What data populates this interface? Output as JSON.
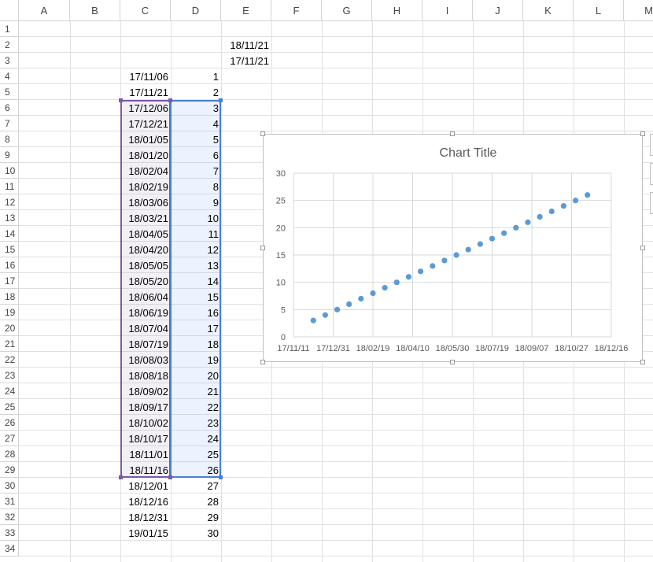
{
  "columns": [
    "A",
    "B",
    "C",
    "D",
    "E",
    "F",
    "G",
    "H",
    "I",
    "J",
    "K",
    "L",
    "M"
  ],
  "rows": [
    "1",
    "2",
    "3",
    "4",
    "5",
    "6",
    "7",
    "8",
    "9",
    "10",
    "11",
    "12",
    "13",
    "14",
    "15",
    "16",
    "17",
    "18",
    "19",
    "20",
    "21",
    "22",
    "23",
    "24",
    "25",
    "26",
    "27",
    "28",
    "29",
    "30",
    "31",
    "32",
    "33",
    "34"
  ],
  "cells": {
    "E2": "18/11/21",
    "E3": "17/11/21",
    "C": [
      "17/11/06",
      "17/11/21",
      "17/12/06",
      "17/12/21",
      "18/01/05",
      "18/01/20",
      "18/02/04",
      "18/02/19",
      "18/03/06",
      "18/03/21",
      "18/04/05",
      "18/04/20",
      "18/05/05",
      "18/05/20",
      "18/06/04",
      "18/06/19",
      "18/07/04",
      "18/07/19",
      "18/08/03",
      "18/08/18",
      "18/09/02",
      "18/09/17",
      "18/10/02",
      "18/10/17",
      "18/11/01",
      "18/11/16",
      "18/12/01",
      "18/12/16",
      "18/12/31",
      "19/01/15"
    ],
    "D": [
      "1",
      "2",
      "3",
      "4",
      "5",
      "6",
      "7",
      "8",
      "9",
      "10",
      "11",
      "12",
      "13",
      "14",
      "15",
      "16",
      "17",
      "18",
      "19",
      "20",
      "21",
      "22",
      "23",
      "24",
      "25",
      "26",
      "27",
      "28",
      "29",
      "30"
    ]
  },
  "selection": {
    "range_c": "C6:C29",
    "range_d": "D6:D29"
  },
  "chart_data": {
    "type": "scatter",
    "title": "Chart Title",
    "x": [
      "17/12/06",
      "17/12/21",
      "18/01/05",
      "18/01/20",
      "18/02/04",
      "18/02/19",
      "18/03/06",
      "18/03/21",
      "18/04/05",
      "18/04/20",
      "18/05/05",
      "18/05/20",
      "18/06/04",
      "18/06/19",
      "18/07/04",
      "18/07/19",
      "18/08/03",
      "18/08/18",
      "18/09/02",
      "18/09/17",
      "18/10/02",
      "18/10/17",
      "18/11/01",
      "18/11/16"
    ],
    "y": [
      3,
      4,
      5,
      6,
      7,
      8,
      9,
      10,
      11,
      12,
      13,
      14,
      15,
      16,
      17,
      18,
      19,
      20,
      21,
      22,
      23,
      24,
      25,
      26
    ],
    "xlim": [
      "17/11/11",
      "18/12/16"
    ],
    "x_ticks": [
      "17/11/11",
      "17/12/31",
      "18/02/19",
      "18/04/10",
      "18/05/30",
      "18/07/19",
      "18/09/07",
      "18/10/27",
      "18/12/16"
    ],
    "ylim": [
      0,
      30
    ],
    "y_ticks": [
      "0",
      "5",
      "10",
      "15",
      "20",
      "25",
      "30"
    ],
    "grid": true,
    "series_color": "#5b9bd5",
    "xlabel": "",
    "ylabel": ""
  }
}
